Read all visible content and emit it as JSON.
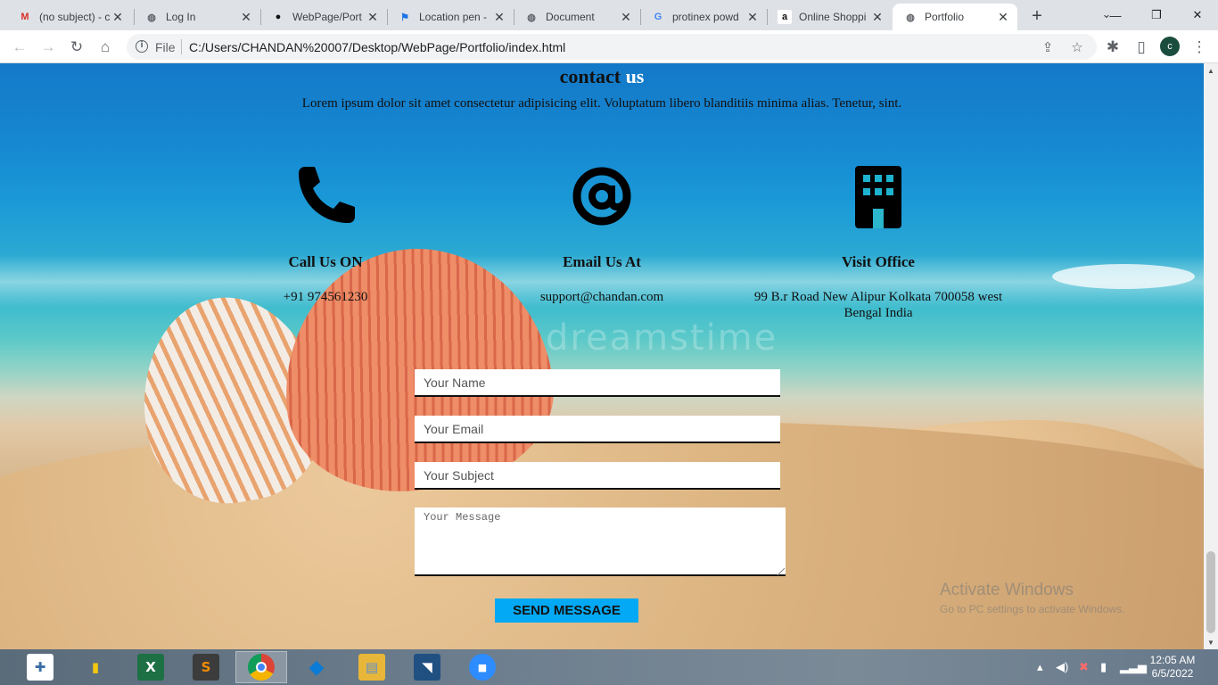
{
  "browser": {
    "tabs": [
      {
        "title": "(no subject) - c",
        "icon": "gmail-icon",
        "active": false
      },
      {
        "title": "Log In",
        "icon": "globe-icon",
        "active": false
      },
      {
        "title": "WebPage/Port",
        "icon": "github-icon",
        "active": false
      },
      {
        "title": "Location pen -",
        "icon": "flag-icon",
        "active": false
      },
      {
        "title": "Document",
        "icon": "globe-icon",
        "active": false
      },
      {
        "title": "protinex powd",
        "icon": "google-icon",
        "active": false
      },
      {
        "title": "Online Shoppi",
        "icon": "amazon-icon",
        "active": false
      },
      {
        "title": "Portfolio",
        "icon": "globe-icon",
        "active": true
      }
    ],
    "omnibox": {
      "scheme_label": "File",
      "url": "C:/Users/CHANDAN%20007/Desktop/WebPage/Portfolio/index.html"
    },
    "profile_initial": "c"
  },
  "page": {
    "contact": {
      "title_main": "contact",
      "title_accent": "us",
      "description": "Lorem ipsum dolor sit amet consectetur adipisicing elit. Voluptatum libero blanditiis minima alias. Tenetur, sint.",
      "columns": [
        {
          "icon": "phone-icon",
          "heading": "Call Us ON",
          "text": "+91 974561230"
        },
        {
          "icon": "at-sign-icon",
          "heading": "Email Us At",
          "text": "support@chandan.com"
        },
        {
          "icon": "building-icon",
          "heading": "Visit Office",
          "text": "99 B.r Road New Alipur Kolkata 700058 west Bengal India"
        }
      ],
      "form": {
        "name_placeholder": "Your Name",
        "email_placeholder": "Your Email",
        "subject_placeholder": "Your Subject",
        "message_placeholder": "Your Message",
        "submit_label": "SEND MESSAGE"
      }
    },
    "background_watermark": "dreamstime",
    "activation": {
      "title": "Activate Windows",
      "subtitle": "Go to PC settings to activate Windows."
    }
  },
  "taskbar": {
    "apps": [
      {
        "name": "tableau-app",
        "glyph": "✚",
        "color": "#3b6ea5"
      },
      {
        "name": "power-bi-app",
        "glyph": "▮",
        "color": "#f2c811"
      },
      {
        "name": "excel-app",
        "glyph": "X",
        "color": "#1d7044"
      },
      {
        "name": "sublime-text-app",
        "glyph": "S",
        "color": "#f28c00"
      },
      {
        "name": "chrome-app",
        "glyph": "●",
        "color": "#db4437"
      },
      {
        "name": "vscode-app",
        "glyph": "◆",
        "color": "#0a7bd6"
      },
      {
        "name": "file-explorer-app",
        "glyph": "▤",
        "color": "#e8b73a"
      },
      {
        "name": "mysql-workbench-app",
        "glyph": "◥",
        "color": "#205081"
      },
      {
        "name": "zoom-app",
        "glyph": "■",
        "color": "#2d8cff"
      }
    ],
    "clock": {
      "time": "12:05 AM",
      "date": "6/5/2022"
    }
  }
}
